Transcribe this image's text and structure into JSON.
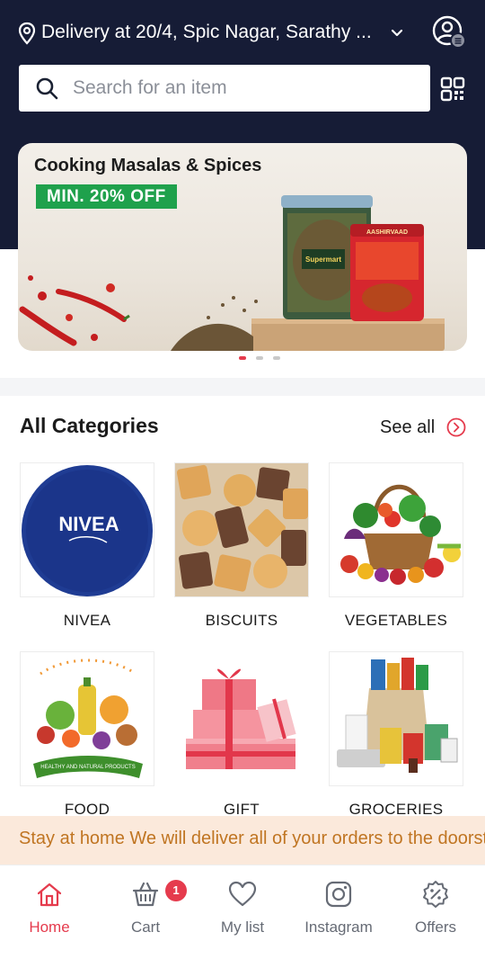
{
  "header": {
    "delivery_location": "Delivery at 20/4, Spic Nagar, Sarathy ...",
    "search_placeholder": "Search for an item"
  },
  "banner": {
    "title": "Cooking Masalas & Spices",
    "offer": "MIN. 20% OFF",
    "slides_total": 3,
    "active_slide": 1
  },
  "categories": {
    "title": "All Categories",
    "see_all": "See all",
    "items": [
      {
        "label": "NIVEA",
        "image_text": "NIVEA"
      },
      {
        "label": "BISCUITS"
      },
      {
        "label": "VEGETABLES"
      },
      {
        "label": "FOOD"
      },
      {
        "label": "GIFT"
      },
      {
        "label": "GROCERIES"
      }
    ]
  },
  "ticker": {
    "text": "Stay at home We will deliver all of your orders to the doorstep"
  },
  "bottom_nav": {
    "items": [
      {
        "label": "Home",
        "icon": "home-icon",
        "active": true
      },
      {
        "label": "Cart",
        "icon": "cart-icon",
        "badge": "1"
      },
      {
        "label": "My list",
        "icon": "heart-icon"
      },
      {
        "label": "Instagram",
        "icon": "instagram-icon"
      },
      {
        "label": "Offers",
        "icon": "offers-badge-icon"
      }
    ]
  },
  "colors": {
    "header_bg": "#161c36",
    "accent": "#e53b4d",
    "offer_green": "#1fa14c",
    "ticker_bg": "#fbe9db",
    "ticker_text": "#c07522"
  }
}
